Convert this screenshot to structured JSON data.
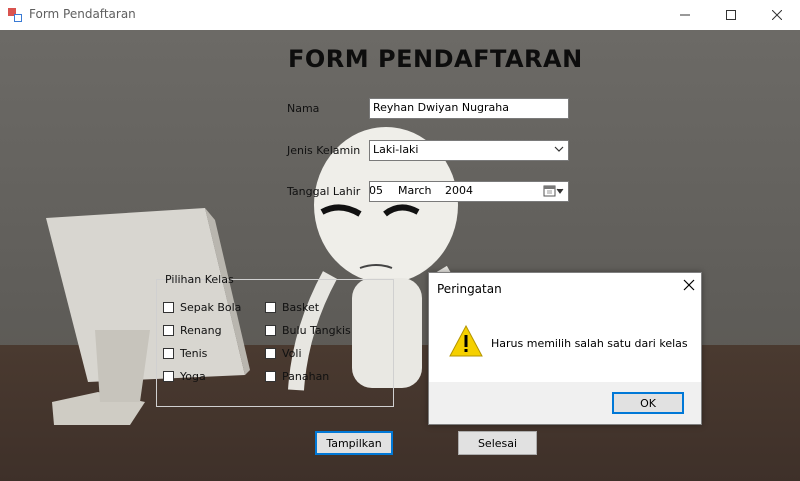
{
  "window": {
    "title": "Form Pendaftaran"
  },
  "form": {
    "heading": "FORM PENDAFTARAN",
    "nama": {
      "label": "Nama",
      "value": "Reyhan Dwiyan Nugraha"
    },
    "jenis_kelamin": {
      "label": "Jenis Kelamin",
      "value": "Laki-laki"
    },
    "tanggal_lahir": {
      "label": "Tanggal Lahir",
      "day": "05",
      "month": "March",
      "year": "2004"
    },
    "pilihan_kelas": {
      "caption": "Pilihan Kelas",
      "options": [
        "Sepak Bola",
        "Renang",
        "Tenis",
        "Yoga",
        "Basket",
        "Bulu Tangkis",
        "Voli",
        "Panahan"
      ]
    },
    "buttons": {
      "tampilkan": "Tampilkan",
      "selesai": "Selesai"
    }
  },
  "dialog": {
    "title": "Peringatan",
    "message": "Harus memilih salah satu dari kelas",
    "ok": "OK",
    "icon": "warning-icon"
  },
  "colors": {
    "accent": "#0078d7",
    "warning": "#f5d000"
  }
}
